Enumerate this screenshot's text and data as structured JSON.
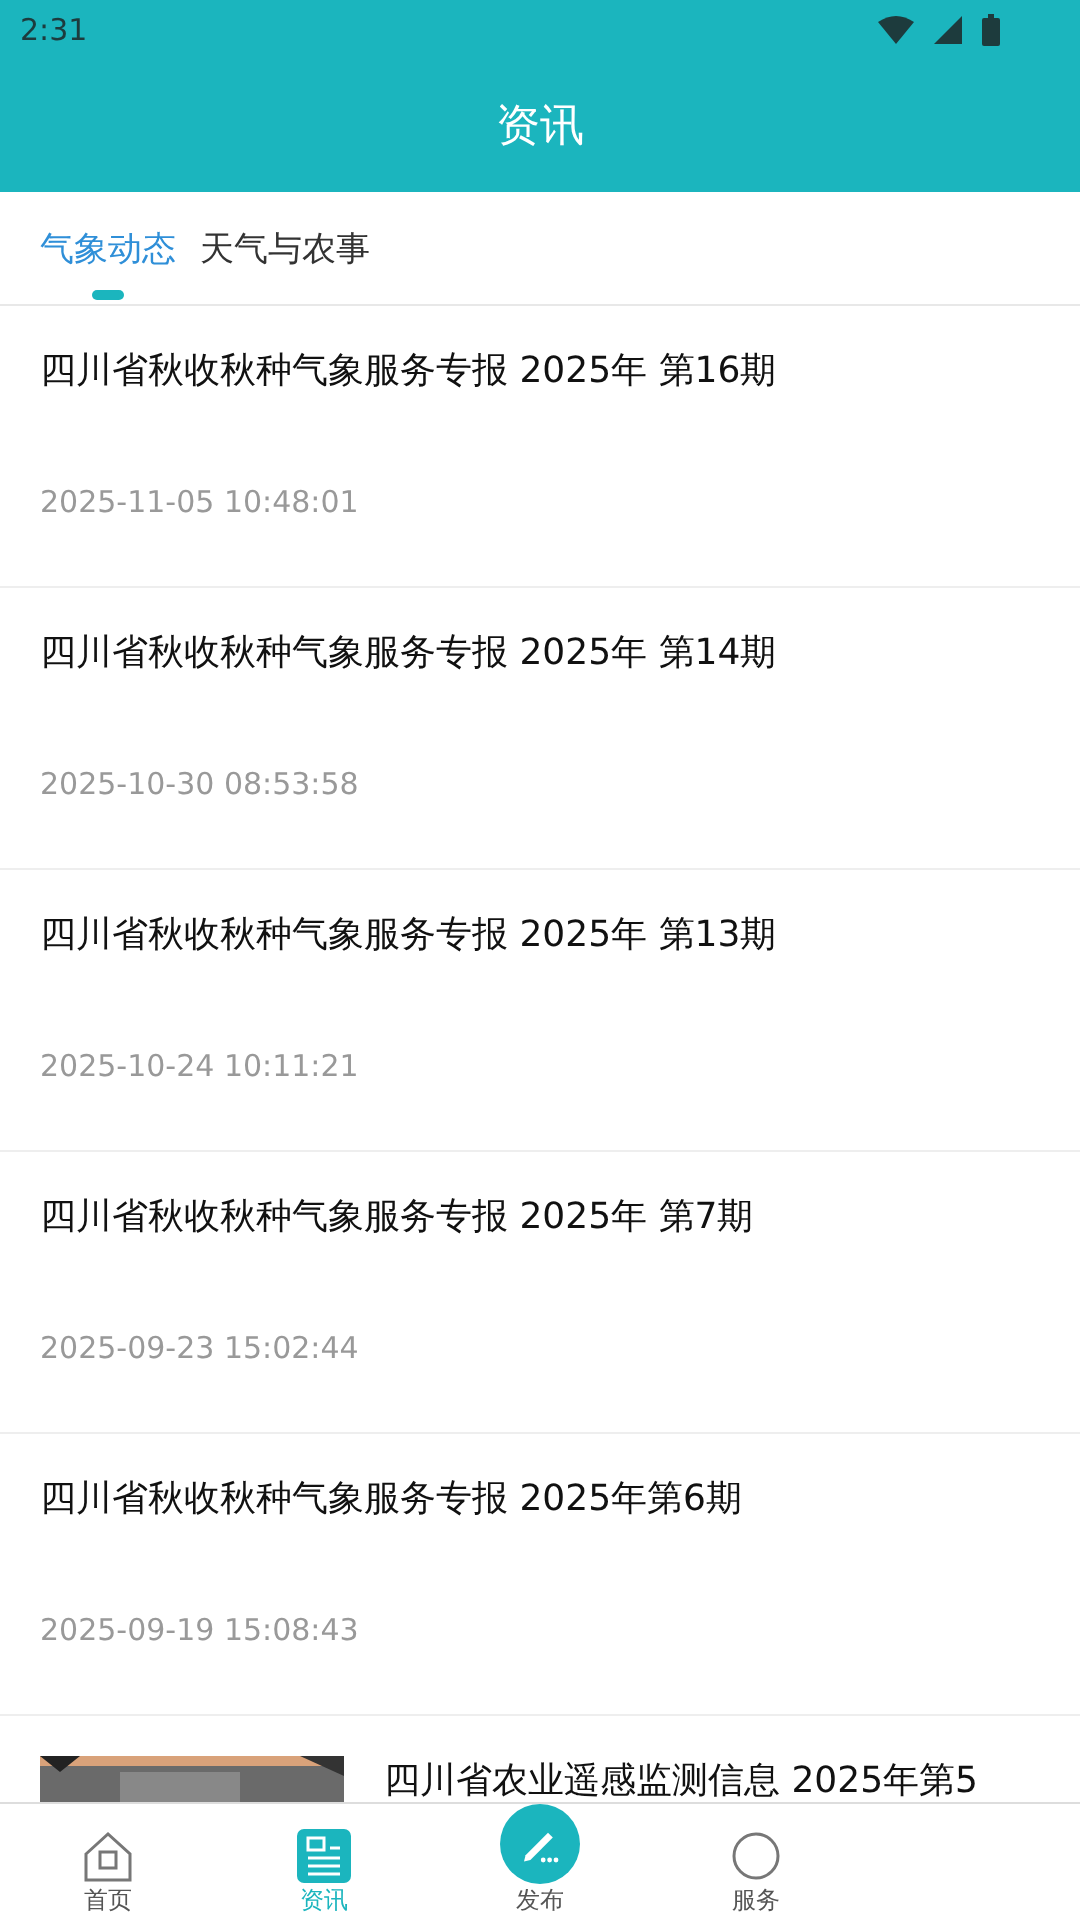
{
  "status_bar": {
    "time": "2:31"
  },
  "header": {
    "title": "资讯"
  },
  "tabs": [
    {
      "label": "气象动态",
      "selected": true
    },
    {
      "label": "天气与农事",
      "selected": false
    }
  ],
  "articles": [
    {
      "title": "四川省秋收秋种气象服务专报 2025年 第16期",
      "date": "2025-11-05 10:48:01"
    },
    {
      "title": "四川省秋收秋种气象服务专报 2025年 第14期",
      "date": "2025-10-30 08:53:58"
    },
    {
      "title": "四川省秋收秋种气象服务专报 2025年 第13期",
      "date": "2025-10-24 10:11:21"
    },
    {
      "title": "四川省秋收秋种气象服务专报 2025年 第7期",
      "date": "2025-09-23 15:02:44"
    },
    {
      "title": "四川省秋收秋种气象服务专报 2025年第6期",
      "date": "2025-09-19 15:08:43"
    },
    {
      "kind": "picture",
      "title": "四川省农业遥感监测信息 2025年第5"
    }
  ],
  "nav": [
    {
      "label": "首页",
      "kind": "home",
      "selected": false
    },
    {
      "label": "资讯",
      "kind": "news",
      "selected": true
    },
    {
      "label": "发布",
      "kind": "publish",
      "selected": false
    },
    {
      "label": "服务",
      "kind": "service",
      "selected": false
    }
  ]
}
